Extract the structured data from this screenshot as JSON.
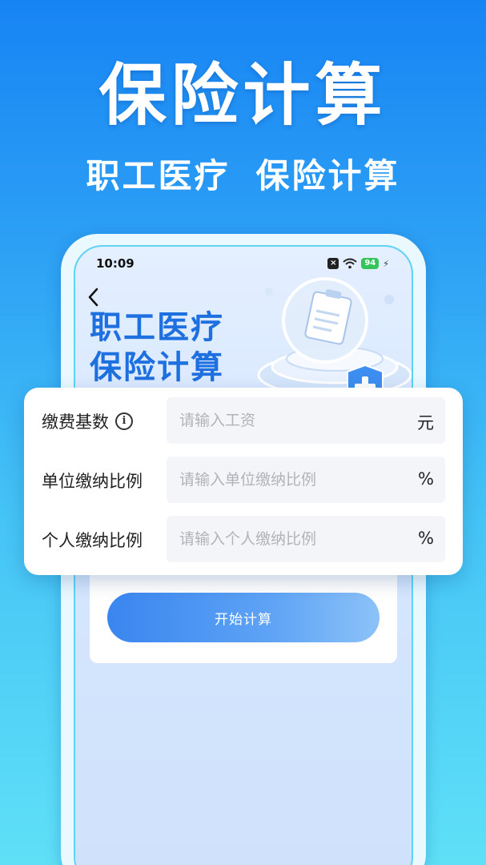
{
  "promo": {
    "title": "保险计算",
    "subtitle_left": "职工医疗",
    "subtitle_right": "保险计算"
  },
  "status_bar": {
    "time": "10:09",
    "battery": "94"
  },
  "hero": {
    "line1": "职工医疗",
    "line2": "保险计算"
  },
  "form": {
    "rows": [
      {
        "label": "缴费基数",
        "placeholder": "请输入工资",
        "unit": "元"
      },
      {
        "label": "单位缴纳比例",
        "placeholder": "请输入单位缴纳比例",
        "unit": "%"
      },
      {
        "label": "个人缴纳比例",
        "placeholder": "请输入个人缴纳比例",
        "unit": "%"
      }
    ]
  },
  "start_button_label": "开始计算",
  "colors": {
    "accent": "#1e6fe0",
    "button_gradient_start": "#3a86f0",
    "battery": "#35c45b"
  },
  "icons": [
    "back-icon",
    "info-icon",
    "wifi-icon",
    "battery-icon",
    "close-icon",
    "bolt-icon",
    "clipboard-icon",
    "shield-plus-icon"
  ]
}
